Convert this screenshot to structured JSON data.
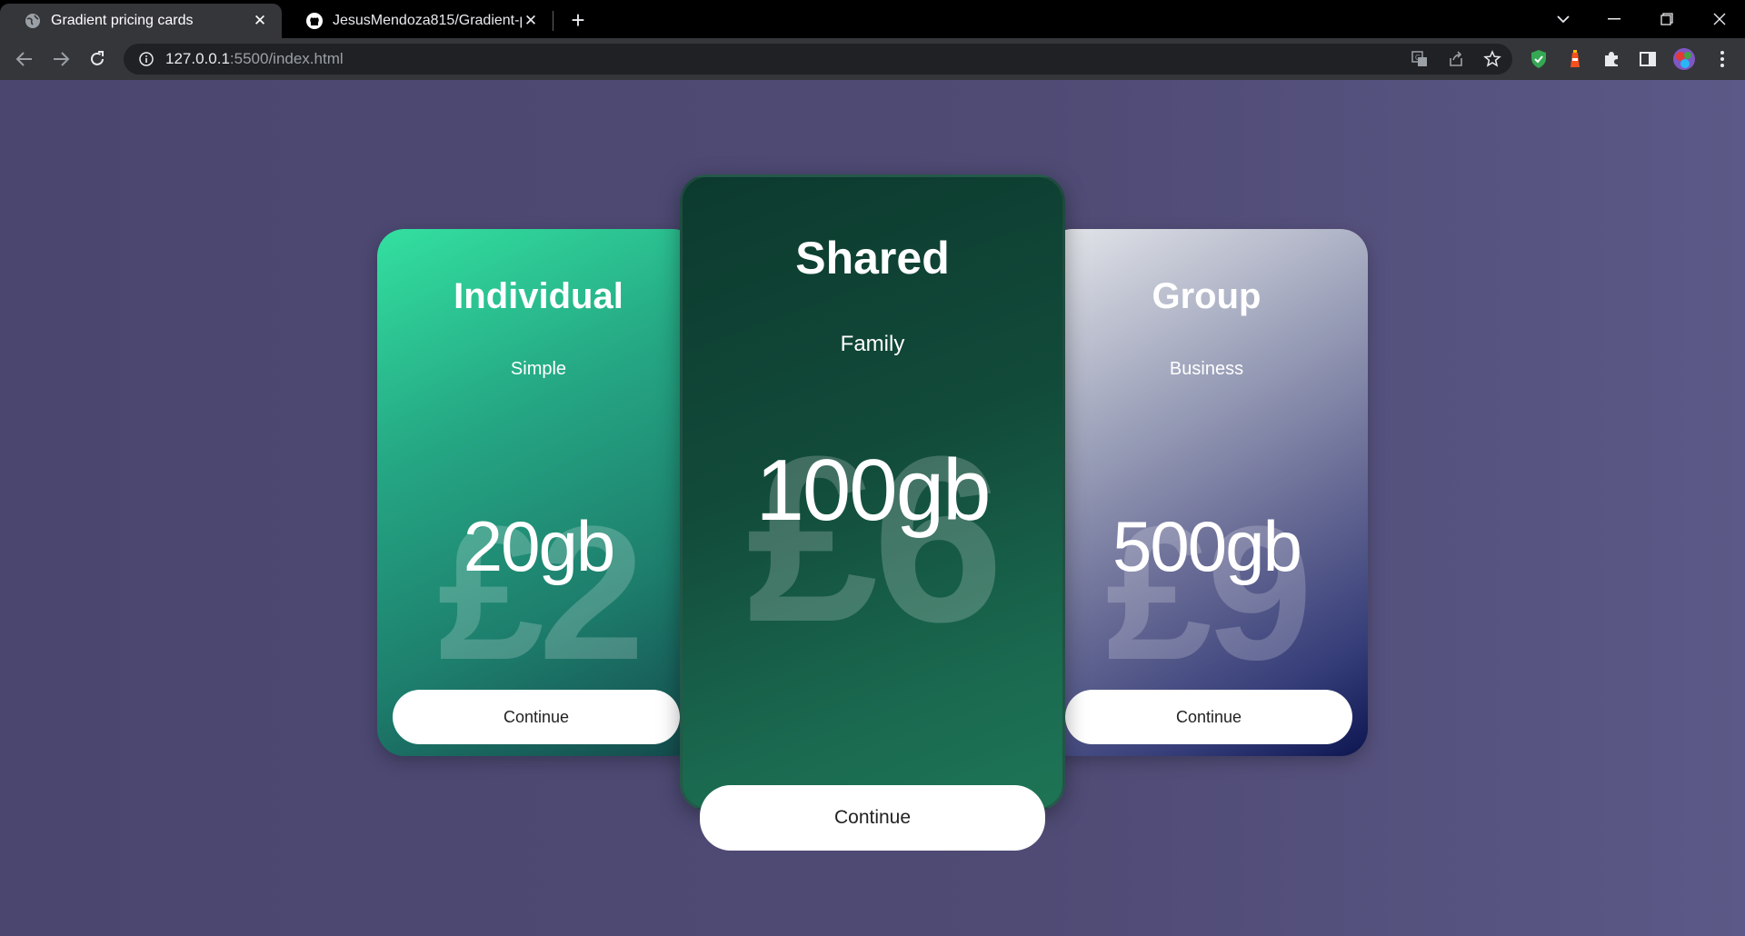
{
  "browser": {
    "tabs": [
      {
        "title": "Gradient pricing cards",
        "favicon": "globe-icon",
        "active": true
      },
      {
        "title": "JesusMendoza815/Gradient-prici",
        "favicon": "github-icon",
        "active": false
      }
    ],
    "url_host": "127.0.0.1",
    "url_path": ":5500/index.html"
  },
  "cards": {
    "individual": {
      "title": "Individual",
      "subtitle": "Simple",
      "price": "£2",
      "storage": "20gb",
      "button": "Continue"
    },
    "shared": {
      "title": "Shared",
      "subtitle": "Family",
      "price": "£6",
      "storage": "100gb",
      "button": "Continue"
    },
    "group": {
      "title": "Group",
      "subtitle": "Business",
      "price": "£9",
      "storage": "500gb",
      "button": "Continue"
    }
  },
  "colors": {
    "page_background": "#4f4b75",
    "individual_gradient_start": "#33e0a0",
    "shared_gradient_start": "#0c3a2e",
    "group_gradient_end": "#0d1650"
  }
}
